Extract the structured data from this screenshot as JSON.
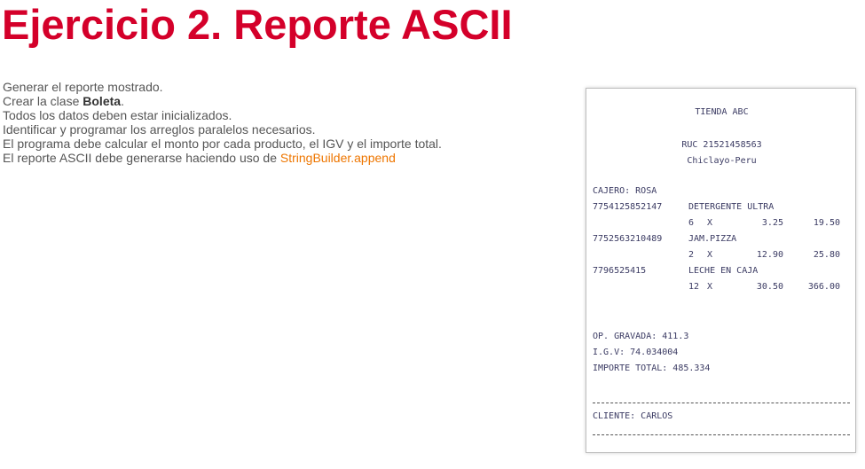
{
  "title": "Ejercicio 2. Reporte ASCII",
  "instructions": {
    "line1": "Generar el reporte mostrado.",
    "line2_prefix": "Crear la clase ",
    "line2_bold": "Boleta",
    "line2_suffix": ".",
    "line3": "Todos los datos deben estar inicializados.",
    "line4": "Identificar y programar los arreglos paralelos necesarios.",
    "line5": "El programa debe calcular el monto por cada producto, el IGV y el importe total.",
    "line6_prefix": "El reporte ASCII debe generarse haciendo uso de ",
    "line6_highlight": "StringBuilder.append"
  },
  "receipt": {
    "store": "TIENDA ABC",
    "ruc": "RUC 21521458563",
    "location": "Chiclayo-Peru",
    "cashier": "CAJERO: ROSA",
    "items": [
      {
        "code": "7754125852147",
        "name": "DETERGENTE ULTRA",
        "qty": "6",
        "x": "X",
        "price": "3.25",
        "amount": "19.50"
      },
      {
        "code": "7752563210489",
        "name": "JAM.PIZZA",
        "qty": "2",
        "x": "X",
        "price": "12.90",
        "amount": "25.80"
      },
      {
        "code": "7796525415",
        "name": "LECHE EN CAJA",
        "qty": "12",
        "x": "X",
        "price": "30.50",
        "amount": "366.00"
      }
    ],
    "op_gravada": "OP. GRAVADA: 411.3",
    "igv": "I.G.V: 74.034004",
    "total": "IMPORTE TOTAL: 485.334",
    "client": "CLIENTE: CARLOS"
  },
  "colors": {
    "title": "#d4002a",
    "highlight": "#ee7600"
  }
}
